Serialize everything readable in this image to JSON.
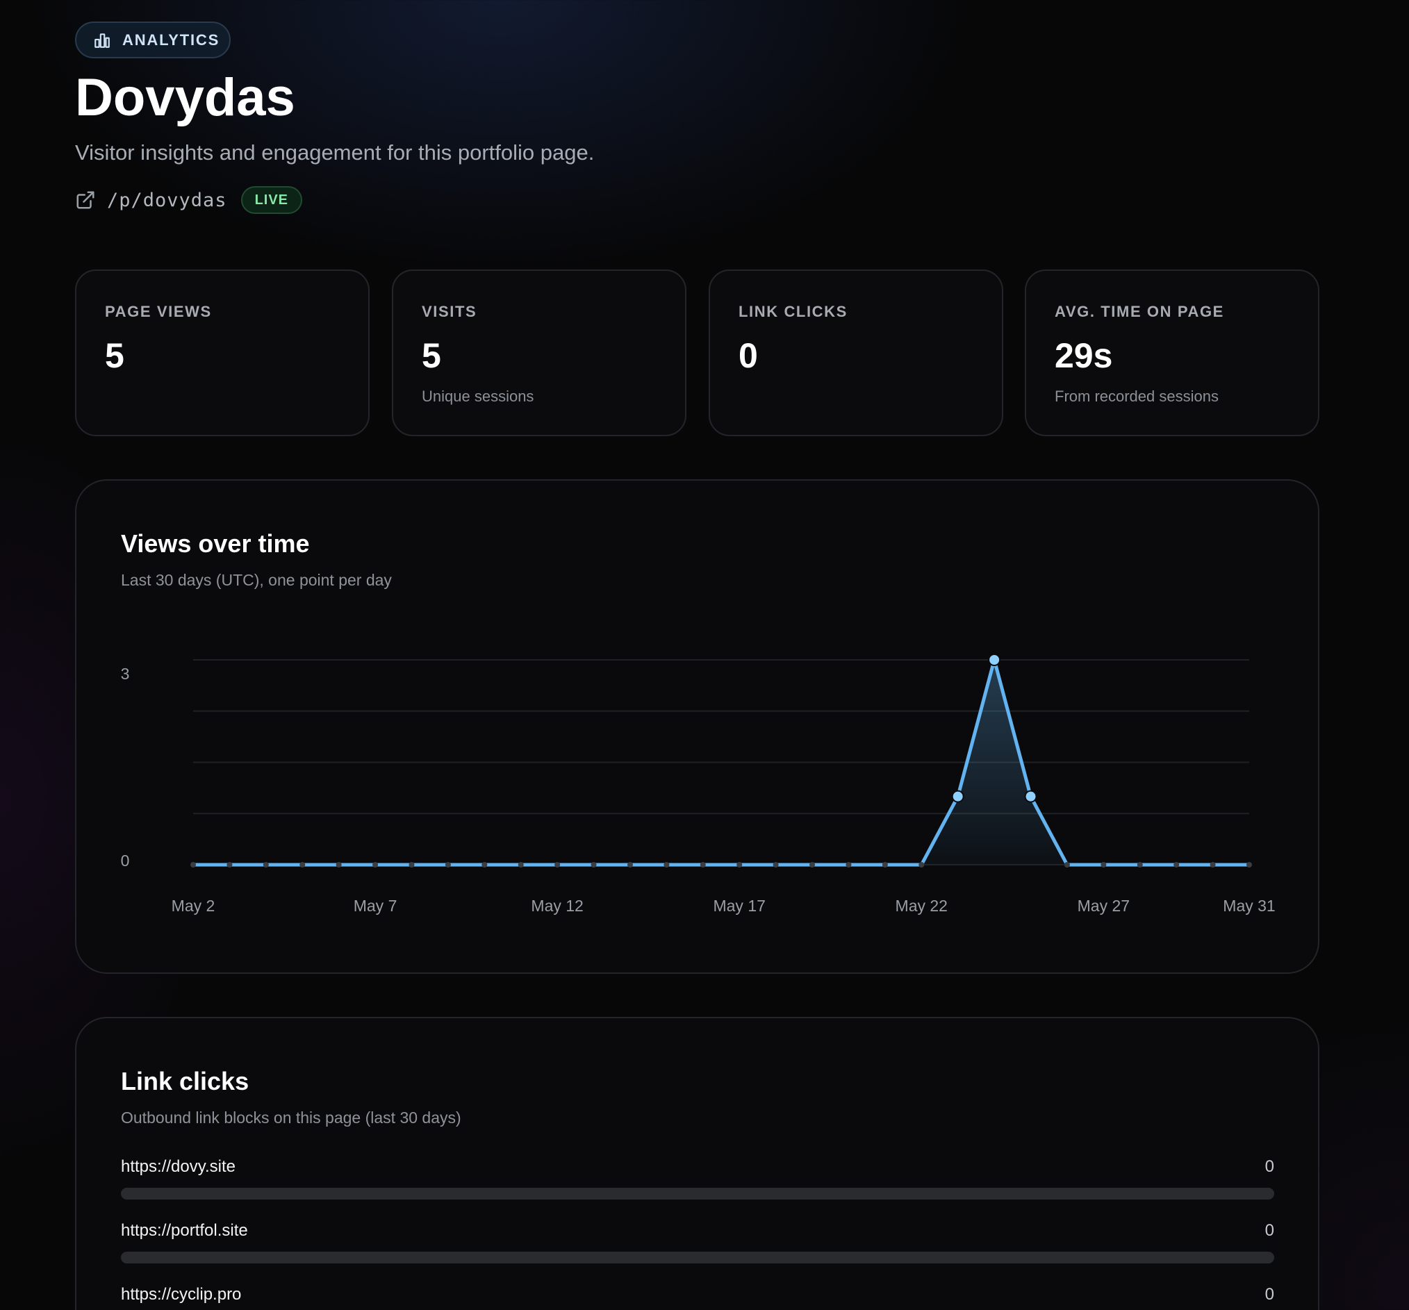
{
  "header": {
    "badge_icon": "bar-chart-icon",
    "badge_label": "ANALYTICS",
    "title": "Dovydas",
    "subtitle": "Visitor insights and engagement for this portfolio page.",
    "url_icon": "external-link-icon",
    "url": "/p/dovydas",
    "status": "LIVE"
  },
  "stats": [
    {
      "label": "PAGE VIEWS",
      "value": "5",
      "sub": ""
    },
    {
      "label": "VISITS",
      "value": "5",
      "sub": "Unique sessions"
    },
    {
      "label": "LINK CLICKS",
      "value": "0",
      "sub": ""
    },
    {
      "label": "AVG. TIME ON PAGE",
      "value": "29s",
      "sub": "From recorded sessions"
    }
  ],
  "views_card": {
    "title": "Views over time",
    "subtitle": "Last 30 days (UTC), one point per day"
  },
  "chart_data": {
    "type": "area",
    "x": [
      "May 2",
      "May 3",
      "May 4",
      "May 5",
      "May 6",
      "May 7",
      "May 8",
      "May 9",
      "May 10",
      "May 11",
      "May 12",
      "May 13",
      "May 14",
      "May 15",
      "May 16",
      "May 17",
      "May 18",
      "May 19",
      "May 20",
      "May 21",
      "May 22",
      "May 23",
      "May 24",
      "May 25",
      "May 26",
      "May 27",
      "May 28",
      "May 29",
      "May 30",
      "May 31"
    ],
    "values": [
      0,
      0,
      0,
      0,
      0,
      0,
      0,
      0,
      0,
      0,
      0,
      0,
      0,
      0,
      0,
      0,
      0,
      0,
      0,
      0,
      0,
      1,
      3,
      1,
      0,
      0,
      0,
      0,
      0,
      0
    ],
    "x_tick_labels": [
      "May 2",
      "May 7",
      "May 12",
      "May 17",
      "May 22",
      "May 27",
      "May 31"
    ],
    "y_tick_labels": [
      "3",
      "0"
    ],
    "ylim": [
      0,
      3
    ],
    "grid": true,
    "legend": "none",
    "colors": {
      "line": "#62b3ef",
      "marker": "#8fd0ff",
      "zero_marker": "#3a3d42"
    }
  },
  "links_card": {
    "title": "Link clicks",
    "subtitle": "Outbound link blocks on this page (last 30 days)",
    "links": [
      {
        "url": "https://dovy.site",
        "count": "0",
        "share": 0
      },
      {
        "url": "https://portfol.site",
        "count": "0",
        "share": 0
      },
      {
        "url": "https://cyclip.pro",
        "count": "0",
        "share": 0
      }
    ]
  }
}
